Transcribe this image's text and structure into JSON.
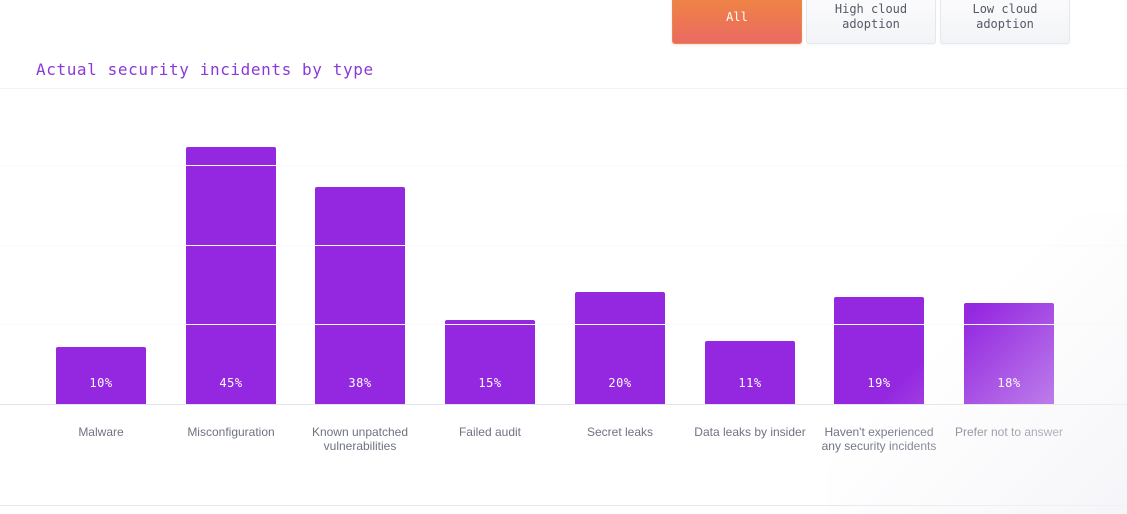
{
  "filters": {
    "buttons": [
      {
        "label": "All",
        "active": true
      },
      {
        "label": "High cloud\nadoption",
        "active": false
      },
      {
        "label": "Low cloud\nadoption",
        "active": false
      }
    ]
  },
  "chart": {
    "title": "Actual security incidents by type",
    "title_color": "#8b39d8",
    "bar_color": "#9427e0",
    "value_label_color": "#ffffff",
    "category_label_color": "#6f7382",
    "gridline_color": "#eceaf0"
  },
  "chart_data": {
    "type": "bar",
    "title": "Actual security incidents by type",
    "xlabel": "",
    "ylabel": "",
    "ylim": [
      0,
      50
    ],
    "grid": true,
    "legend": "none",
    "value_format": "percent",
    "categories": [
      "Malware",
      "Misconfiguration",
      "Known unpatched vulnerabilities",
      "Failed audit",
      "Secret leaks",
      "Data leaks by insider",
      "Haven't experienced any security incidents",
      "Prefer not to answer"
    ],
    "values": [
      10,
      45,
      38,
      15,
      20,
      11,
      19,
      18
    ],
    "value_labels": [
      "10%",
      "45%",
      "38%",
      "15%",
      "20%",
      "11%",
      "19%",
      "18%"
    ]
  }
}
